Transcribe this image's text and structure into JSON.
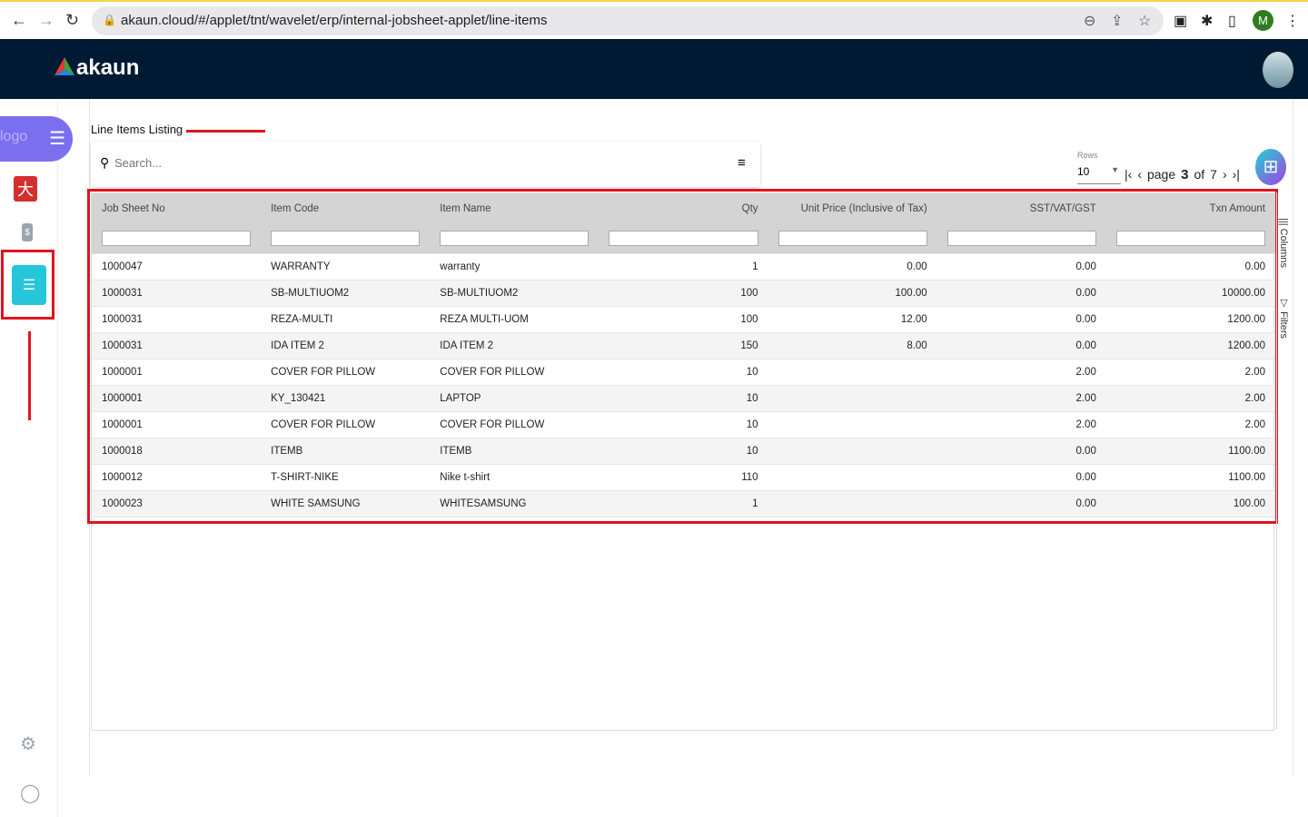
{
  "browser": {
    "url": "akaun.cloud/#/applet/tnt/wavelet/erp/internal-jobsheet-applet/line-items",
    "profile_initial": "M"
  },
  "app": {
    "brand": "akaun",
    "sidebar_logo_alt": "logo"
  },
  "page": {
    "title": "Line Items Listing",
    "search_placeholder": "Search..."
  },
  "pagination": {
    "rows_label": "Rows",
    "rows_value": "10",
    "page_label": "page",
    "current_page": "3",
    "of_label": "of",
    "total_pages": "7"
  },
  "side_tabs": {
    "columns": "Columns",
    "filters": "Filters"
  },
  "table": {
    "columns": [
      "Job Sheet No",
      "Item Code",
      "Item Name",
      "Qty",
      "Unit Price (Inclusive of Tax)",
      "SST/VAT/GST",
      "Txn Amount"
    ],
    "rows": [
      [
        "1000047",
        "WARRANTY",
        "warranty",
        "1",
        "0.00",
        "0.00",
        "0.00"
      ],
      [
        "1000031",
        "SB-MULTIUOM2",
        "SB-MULTIUOM2",
        "100",
        "100.00",
        "0.00",
        "10000.00"
      ],
      [
        "1000031",
        "REZA-MULTI",
        "REZA MULTI-UOM",
        "100",
        "12.00",
        "0.00",
        "1200.00"
      ],
      [
        "1000031",
        "IDA ITEM 2",
        "IDA ITEM 2",
        "150",
        "8.00",
        "0.00",
        "1200.00"
      ],
      [
        "1000001",
        "COVER FOR PILLOW",
        "COVER FOR PILLOW",
        "10",
        "",
        "2.00",
        "2.00"
      ],
      [
        "1000001",
        "KY_130421",
        "LAPTOP",
        "10",
        "",
        "2.00",
        "2.00"
      ],
      [
        "1000001",
        "COVER FOR PILLOW",
        "COVER FOR PILLOW",
        "10",
        "",
        "2.00",
        "2.00"
      ],
      [
        "1000018",
        "ITEMB",
        "ITEMB",
        "10",
        "",
        "0.00",
        "1100.00"
      ],
      [
        "1000012",
        "T-SHIRT-NIKE",
        "Nike t-shirt",
        "110",
        "",
        "0.00",
        "1100.00"
      ],
      [
        "1000023",
        "WHITE SAMSUNG",
        "WHITESAMSUNG",
        "1",
        "",
        "0.00",
        "100.00"
      ]
    ]
  },
  "colors": {
    "topbar": "#001a33",
    "accent": "#26c6da",
    "highlight": "#e0141e",
    "sidebar_pill": "#7b6ff0"
  }
}
